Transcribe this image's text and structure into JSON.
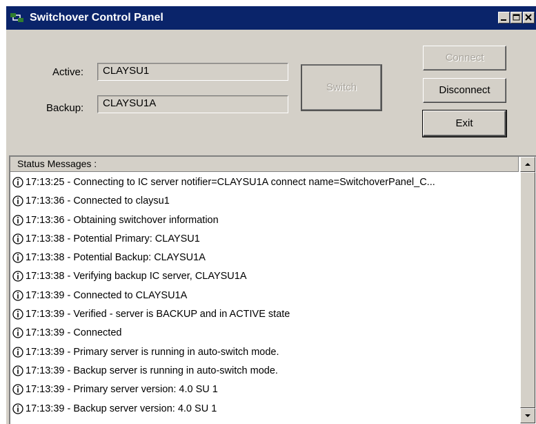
{
  "window": {
    "title": "Switchover Control Panel"
  },
  "form": {
    "active_label": "Active:",
    "active_value": "CLAYSU1",
    "backup_label": "Backup:",
    "backup_value": "CLAYSU1A"
  },
  "buttons": {
    "switch": "Switch",
    "connect": "Connect",
    "disconnect": "Disconnect",
    "exit": "Exit"
  },
  "status": {
    "header": "Status Messages :",
    "messages": [
      "17:13:25 - Connecting to IC server notifier=CLAYSU1A connect name=SwitchoverPanel_C...",
      "17:13:36 - Connected to claysu1",
      "17:13:36 - Obtaining switchover information",
      "17:13:38 - Potential Primary:  CLAYSU1",
      "17:13:38 - Potential Backup:  CLAYSU1A",
      "17:13:38 - Verifying backup IC server, CLAYSU1A",
      "17:13:39 - Connected to CLAYSU1A",
      "17:13:39 - Verified - server is BACKUP and in ACTIVE state",
      "17:13:39 - Connected",
      "17:13:39 - Primary server is running in auto-switch mode.",
      "17:13:39 - Backup server is running in auto-switch mode.",
      "17:13:39 - Primary server version: 4.0 SU 1",
      "17:13:39 - Backup server version: 4.0 SU 1"
    ]
  },
  "icons": {
    "app": "switchover-app-icon",
    "message": "info-icon"
  },
  "colors": {
    "titlebar": "#0a246a",
    "face": "#d4d0c8"
  }
}
